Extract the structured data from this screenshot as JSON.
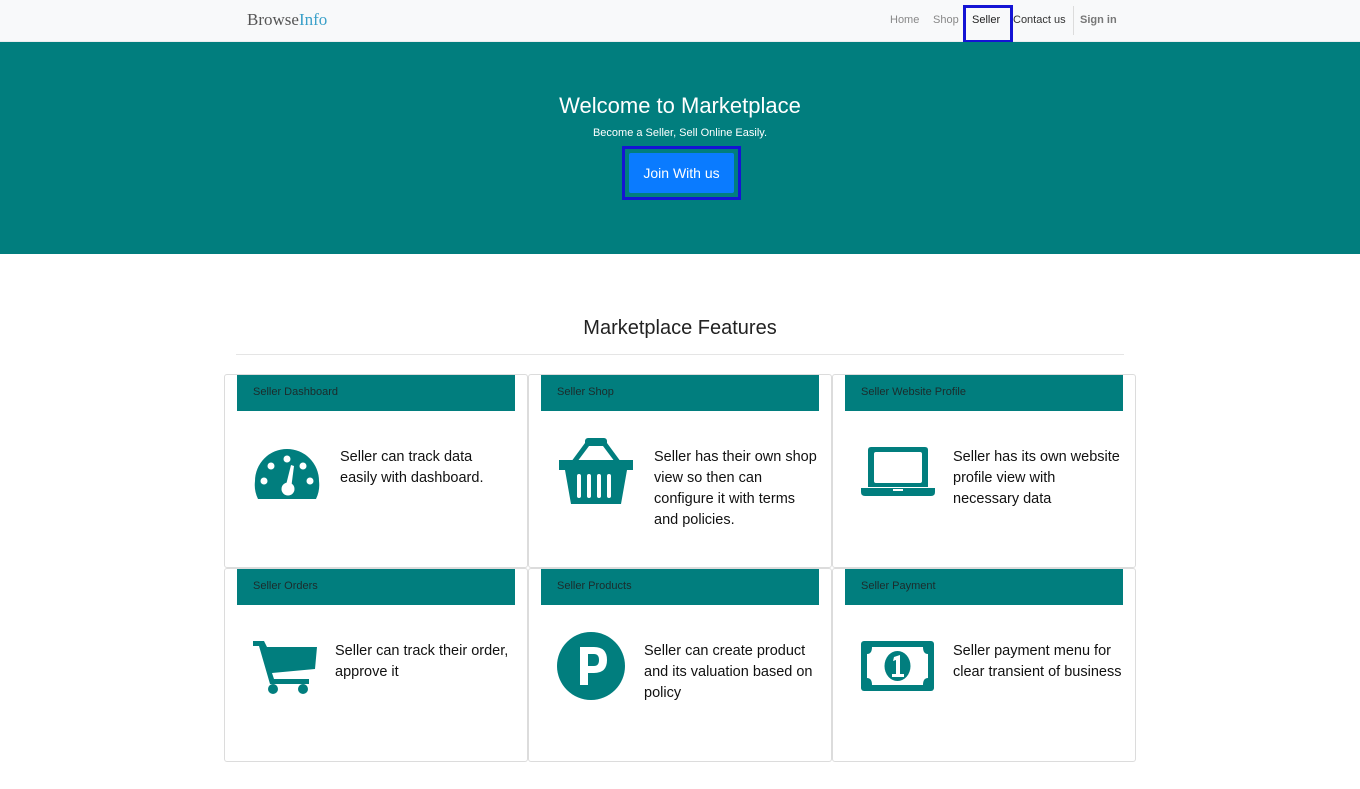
{
  "navbar": {
    "brand_part1": "Browse",
    "brand_part2": "Info",
    "links": {
      "home": "Home",
      "shop": "Shop",
      "seller": "Seller",
      "contact": "Contact us",
      "signin": "Sign in"
    }
  },
  "hero": {
    "title": "Welcome to Marketplace",
    "subtitle": "Become a Seller, Sell Online Easily.",
    "button": "Join With us"
  },
  "features": {
    "title": "Marketplace Features",
    "cards": [
      {
        "header": "Seller Dashboard",
        "text": "Seller can track data easily with dashboard.",
        "icon": "dashboard-icon"
      },
      {
        "header": "Seller Shop",
        "text": "Seller has their own shop view so then can configure it with terms and policies.",
        "icon": "basket-icon"
      },
      {
        "header": "Seller Website Profile",
        "text": "Seller has its own website profile view with necessary data",
        "icon": "laptop-icon"
      },
      {
        "header": "Seller Orders",
        "text": "Seller can track their order, approve it",
        "icon": "cart-icon"
      },
      {
        "header": "Seller Products",
        "text": "Seller can create product and its valuation based on policy",
        "icon": "parking-p-icon"
      },
      {
        "header": "Seller Payment",
        "text": "Seller payment menu for clear transient of business",
        "icon": "money-bill-icon"
      }
    ]
  },
  "colors": {
    "primary_teal": "#017e7e",
    "button_blue": "#0a7bff",
    "highlight_border": "#1414d4"
  }
}
